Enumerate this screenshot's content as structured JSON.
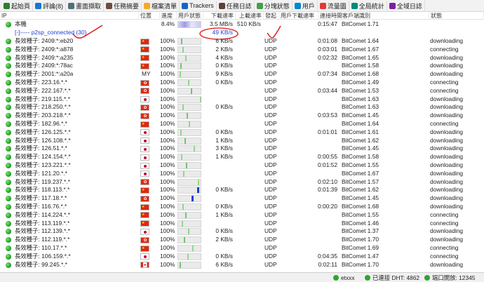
{
  "toolbar": [
    {
      "label": "起始頁",
      "icon": "home-icon",
      "color": "#2e7d32"
    },
    {
      "label": "評論(8)",
      "icon": "comment-icon",
      "color": "#1976d2"
    },
    {
      "label": "畫面擷取",
      "icon": "screenshot-icon",
      "color": "#546e7a"
    },
    {
      "label": "任務摘要",
      "icon": "summary-icon",
      "color": "#6d4c41"
    },
    {
      "label": "檔案清單",
      "icon": "files-icon",
      "color": "#f9a825"
    },
    {
      "label": "Trackers",
      "icon": "tracker-icon",
      "color": "#1565c0"
    },
    {
      "label": "任務日誌",
      "icon": "log-icon",
      "color": "#5d4037"
    },
    {
      "label": "分塊狀態",
      "icon": "pieces-icon",
      "color": "#43a047"
    },
    {
      "label": "用戶",
      "icon": "users-icon",
      "color": "#0288d1"
    },
    {
      "label": "流量圖",
      "icon": "graph-icon",
      "color": "#e53935"
    },
    {
      "label": "全局統計",
      "icon": "stats-icon",
      "color": "#00897b"
    },
    {
      "label": "全域日誌",
      "icon": "globallog-icon",
      "color": "#7b1fa2"
    }
  ],
  "columns": [
    "IP",
    "位置",
    "進度",
    "用戶狀態",
    "下載速率",
    "上載速率",
    "發起",
    "用戶下載速率",
    "連接時間",
    "客戶端識別",
    "狀態"
  ],
  "local": {
    "name": "本機",
    "progress": "8.4%",
    "down": "3.5 MB/s",
    "up": "510 KB/s",
    "time": "0:15:47",
    "client": "BitComet 1.71"
  },
  "group": {
    "label": "[-]----- p2sp_connected (30)",
    "down": "49 KB/s"
  },
  "peers": [
    {
      "ip": "長效種子: 2409:*:eb20",
      "flag": "cn",
      "progress": "100%",
      "down": "6 KB/s",
      "proto": "UDP",
      "time": "0:01:08",
      "client": "BitComet 1.64",
      "status": "downloading"
    },
    {
      "ip": "長效種子: 2409:*:a878",
      "flag": "cn",
      "progress": "100%",
      "down": "2 KB/s",
      "proto": "UDP",
      "time": "0:03:01",
      "client": "BitComet 1.67",
      "status": "connecting"
    },
    {
      "ip": "長效種子: 2409:*:a235",
      "flag": "cn",
      "progress": "100%",
      "down": "4 KB/s",
      "proto": "UDP",
      "time": "0:02:32",
      "client": "BitComet 1.65",
      "status": "downloading"
    },
    {
      "ip": "長效種子: 2409:*:78ac",
      "flag": "cn",
      "progress": "100%",
      "down": "0 KB/s",
      "proto": "UDP",
      "time": "",
      "client": "BitComet 1.58",
      "status": "downloading"
    },
    {
      "ip": "長效種子: 2001:*:a20a",
      "flag": "my",
      "progress": "100%",
      "down": "9 KB/s",
      "proto": "UDP",
      "time": "0:07:34",
      "client": "BitComet 1.68",
      "status": "downloading"
    },
    {
      "ip": "長效種子: 223.16.*.*",
      "flag": "hk",
      "progress": "100%",
      "down": "0 KB/s",
      "proto": "UDP",
      "time": "",
      "client": "BitComet 1.49",
      "status": "connecting"
    },
    {
      "ip": "長效種子: 222.167.*.*",
      "flag": "hk",
      "progress": "100%",
      "down": "",
      "proto": "UDP",
      "time": "0:03:44",
      "client": "BitComet 1.53",
      "status": "connecting"
    },
    {
      "ip": "長效種子: 219.115.*.*",
      "flag": "jp",
      "progress": "100%",
      "down": "",
      "proto": "UDP",
      "time": "",
      "client": "BitComet 1.63",
      "status": "downloading"
    },
    {
      "ip": "長效種子: 218.250.*.*",
      "flag": "hk",
      "progress": "100%",
      "down": "0 KB/s",
      "proto": "UDP",
      "time": "",
      "client": "BitComet 1.63",
      "status": "downloading"
    },
    {
      "ip": "長效種子: 203.218.*.*",
      "flag": "hk",
      "progress": "100%",
      "down": "",
      "proto": "UDP",
      "time": "0:03:53",
      "client": "BitComet 1.45",
      "status": "downloading"
    },
    {
      "ip": "長效種子: 182.96.*.*",
      "flag": "cn",
      "progress": "100%",
      "down": "",
      "proto": "UDP",
      "time": "",
      "client": "BitComet 1.64",
      "status": "connecting"
    },
    {
      "ip": "長效種子: 126.125.*.*",
      "flag": "jp",
      "progress": "100%",
      "down": "0 KB/s",
      "proto": "UDP",
      "time": "0:01:01",
      "client": "BitComet 1.61",
      "status": "downloading"
    },
    {
      "ip": "長效種子: 126.108.*.*",
      "flag": "jp",
      "progress": "100%",
      "down": "1 KB/s",
      "proto": "UDP",
      "time": "",
      "client": "BitComet 1.62",
      "status": "downloading"
    },
    {
      "ip": "長效種子: 126.51.*.*",
      "flag": "jp",
      "progress": "100%",
      "down": "3 KB/s",
      "proto": "UDP",
      "time": "",
      "client": "BitComet 1.45",
      "status": "downloading"
    },
    {
      "ip": "長效種子: 124.154.*.*",
      "flag": "jp",
      "progress": "100%",
      "down": "1 KB/s",
      "proto": "UDP",
      "time": "0:00:55",
      "client": "BitComet 1.58",
      "status": "downloading"
    },
    {
      "ip": "長效種子: 123.221.*.*",
      "flag": "jp",
      "progress": "100%",
      "down": "",
      "proto": "UDP",
      "time": "0:01:52",
      "client": "BitComet 1.55",
      "status": "downloading"
    },
    {
      "ip": "長效種子: 121.20.*.*",
      "flag": "jp",
      "progress": "100%",
      "down": "",
      "proto": "UDP",
      "time": "",
      "client": "BitComet 1.67",
      "status": "downloading"
    },
    {
      "ip": "長效種子: 119.237.*.*",
      "flag": "hk",
      "progress": "100%",
      "down": "",
      "proto": "UDP",
      "time": "0:02:10",
      "client": "BitComet 1.57",
      "status": "downloading"
    },
    {
      "ip": "長效種子: 118.113.*.*",
      "flag": "cn",
      "progress": "100%",
      "down": "0 KB/s",
      "proto": "UDP",
      "time": "0:01:39",
      "client": "BitComet 1.62",
      "status": "downloading"
    },
    {
      "ip": "長效種子: 117.18.*.*",
      "flag": "hk",
      "progress": "100%",
      "down": "",
      "proto": "UDP",
      "time": "",
      "client": "BitComet 1.45",
      "status": "downloading"
    },
    {
      "ip": "長效種子: 116.76.*.*",
      "flag": "cn",
      "progress": "100%",
      "down": "0 KB/s",
      "proto": "UDP",
      "time": "0:00:20",
      "client": "BitComet 1.68",
      "status": "downloading"
    },
    {
      "ip": "長效種子: 114.224.*.*",
      "flag": "cn",
      "progress": "100%",
      "down": "1 KB/s",
      "proto": "UDP",
      "time": "",
      "client": "BitComet 1.55",
      "status": "connecting"
    },
    {
      "ip": "長效種子: 113.119.*.*",
      "flag": "cn",
      "progress": "100%",
      "down": "",
      "proto": "UDP",
      "time": "",
      "client": "BitComet 1.46",
      "status": "connecting"
    },
    {
      "ip": "長效種子: 112.139.*.*",
      "flag": "jp",
      "progress": "100%",
      "down": "0 KB/s",
      "proto": "UDP",
      "time": "",
      "client": "BitComet 1.37",
      "status": "downloading"
    },
    {
      "ip": "長效種子: 112.119.*.*",
      "flag": "hk",
      "progress": "100%",
      "down": "2 KB/s",
      "proto": "UDP",
      "time": "",
      "client": "BitComet 1.70",
      "status": "downloading"
    },
    {
      "ip": "長效種子: 110.17.*.*",
      "flag": "cn",
      "progress": "100%",
      "down": "",
      "proto": "UDP",
      "time": "",
      "client": "BitComet 1.69",
      "status": "connecting"
    },
    {
      "ip": "長效種子: 106.159.*.*",
      "flag": "jp",
      "progress": "100%",
      "down": "0 KB/s",
      "proto": "UDP",
      "time": "0:04:35",
      "client": "BitComet 1.47",
      "status": "connecting"
    },
    {
      "ip": "長效種子: 99.245.*.*",
      "flag": "ca",
      "progress": "100%",
      "down": "6 KB/s",
      "proto": "UDP",
      "time": "0:02:11",
      "client": "BitComet 1.70",
      "status": "downloading"
    }
  ],
  "status_bar": {
    "user": "etxxx",
    "dht": "已連接 DHT: 4862",
    "port": "端口開放: 12345"
  },
  "colors": {
    "cn": "#de2910",
    "hk": "#de2910",
    "jp": "#ffffff",
    "my": "#ffffff",
    "ca": "#d52b1e",
    "accent": "#1a3fd1"
  }
}
